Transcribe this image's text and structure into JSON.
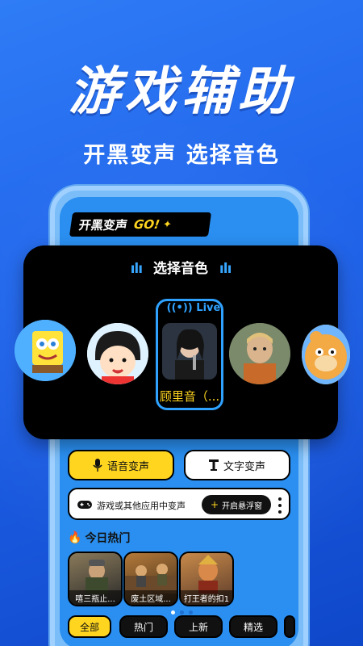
{
  "hero": {
    "title": "游戏辅助",
    "subtitle": "开黑变声 选择音色"
  },
  "brand_banner": {
    "text": "开黑变声",
    "go": "GO!"
  },
  "voice_panel": {
    "title": "选择音色",
    "live_tag": "Live",
    "selected_name": "顾里音（...",
    "avatars": [
      "sponge-character",
      "cartoon-girl",
      "singer",
      "monk",
      "bear-character"
    ]
  },
  "actions": {
    "voice_change": "语音变声",
    "text_change": "文字变声"
  },
  "game_row": {
    "label": "游戏或其他应用中变声",
    "float_button": "开启悬浮窗"
  },
  "hot": {
    "title": "今日热门",
    "cards": [
      "嘻三瓶止...",
      "废土区域...",
      "打王者的扣1"
    ]
  },
  "filters": [
    "全部",
    "热门",
    "上新",
    "精选",
    ""
  ],
  "colors": {
    "accent": "#ffd51f",
    "brand_blue": "#2f7cf6",
    "live_blue": "#2fa2ff"
  }
}
